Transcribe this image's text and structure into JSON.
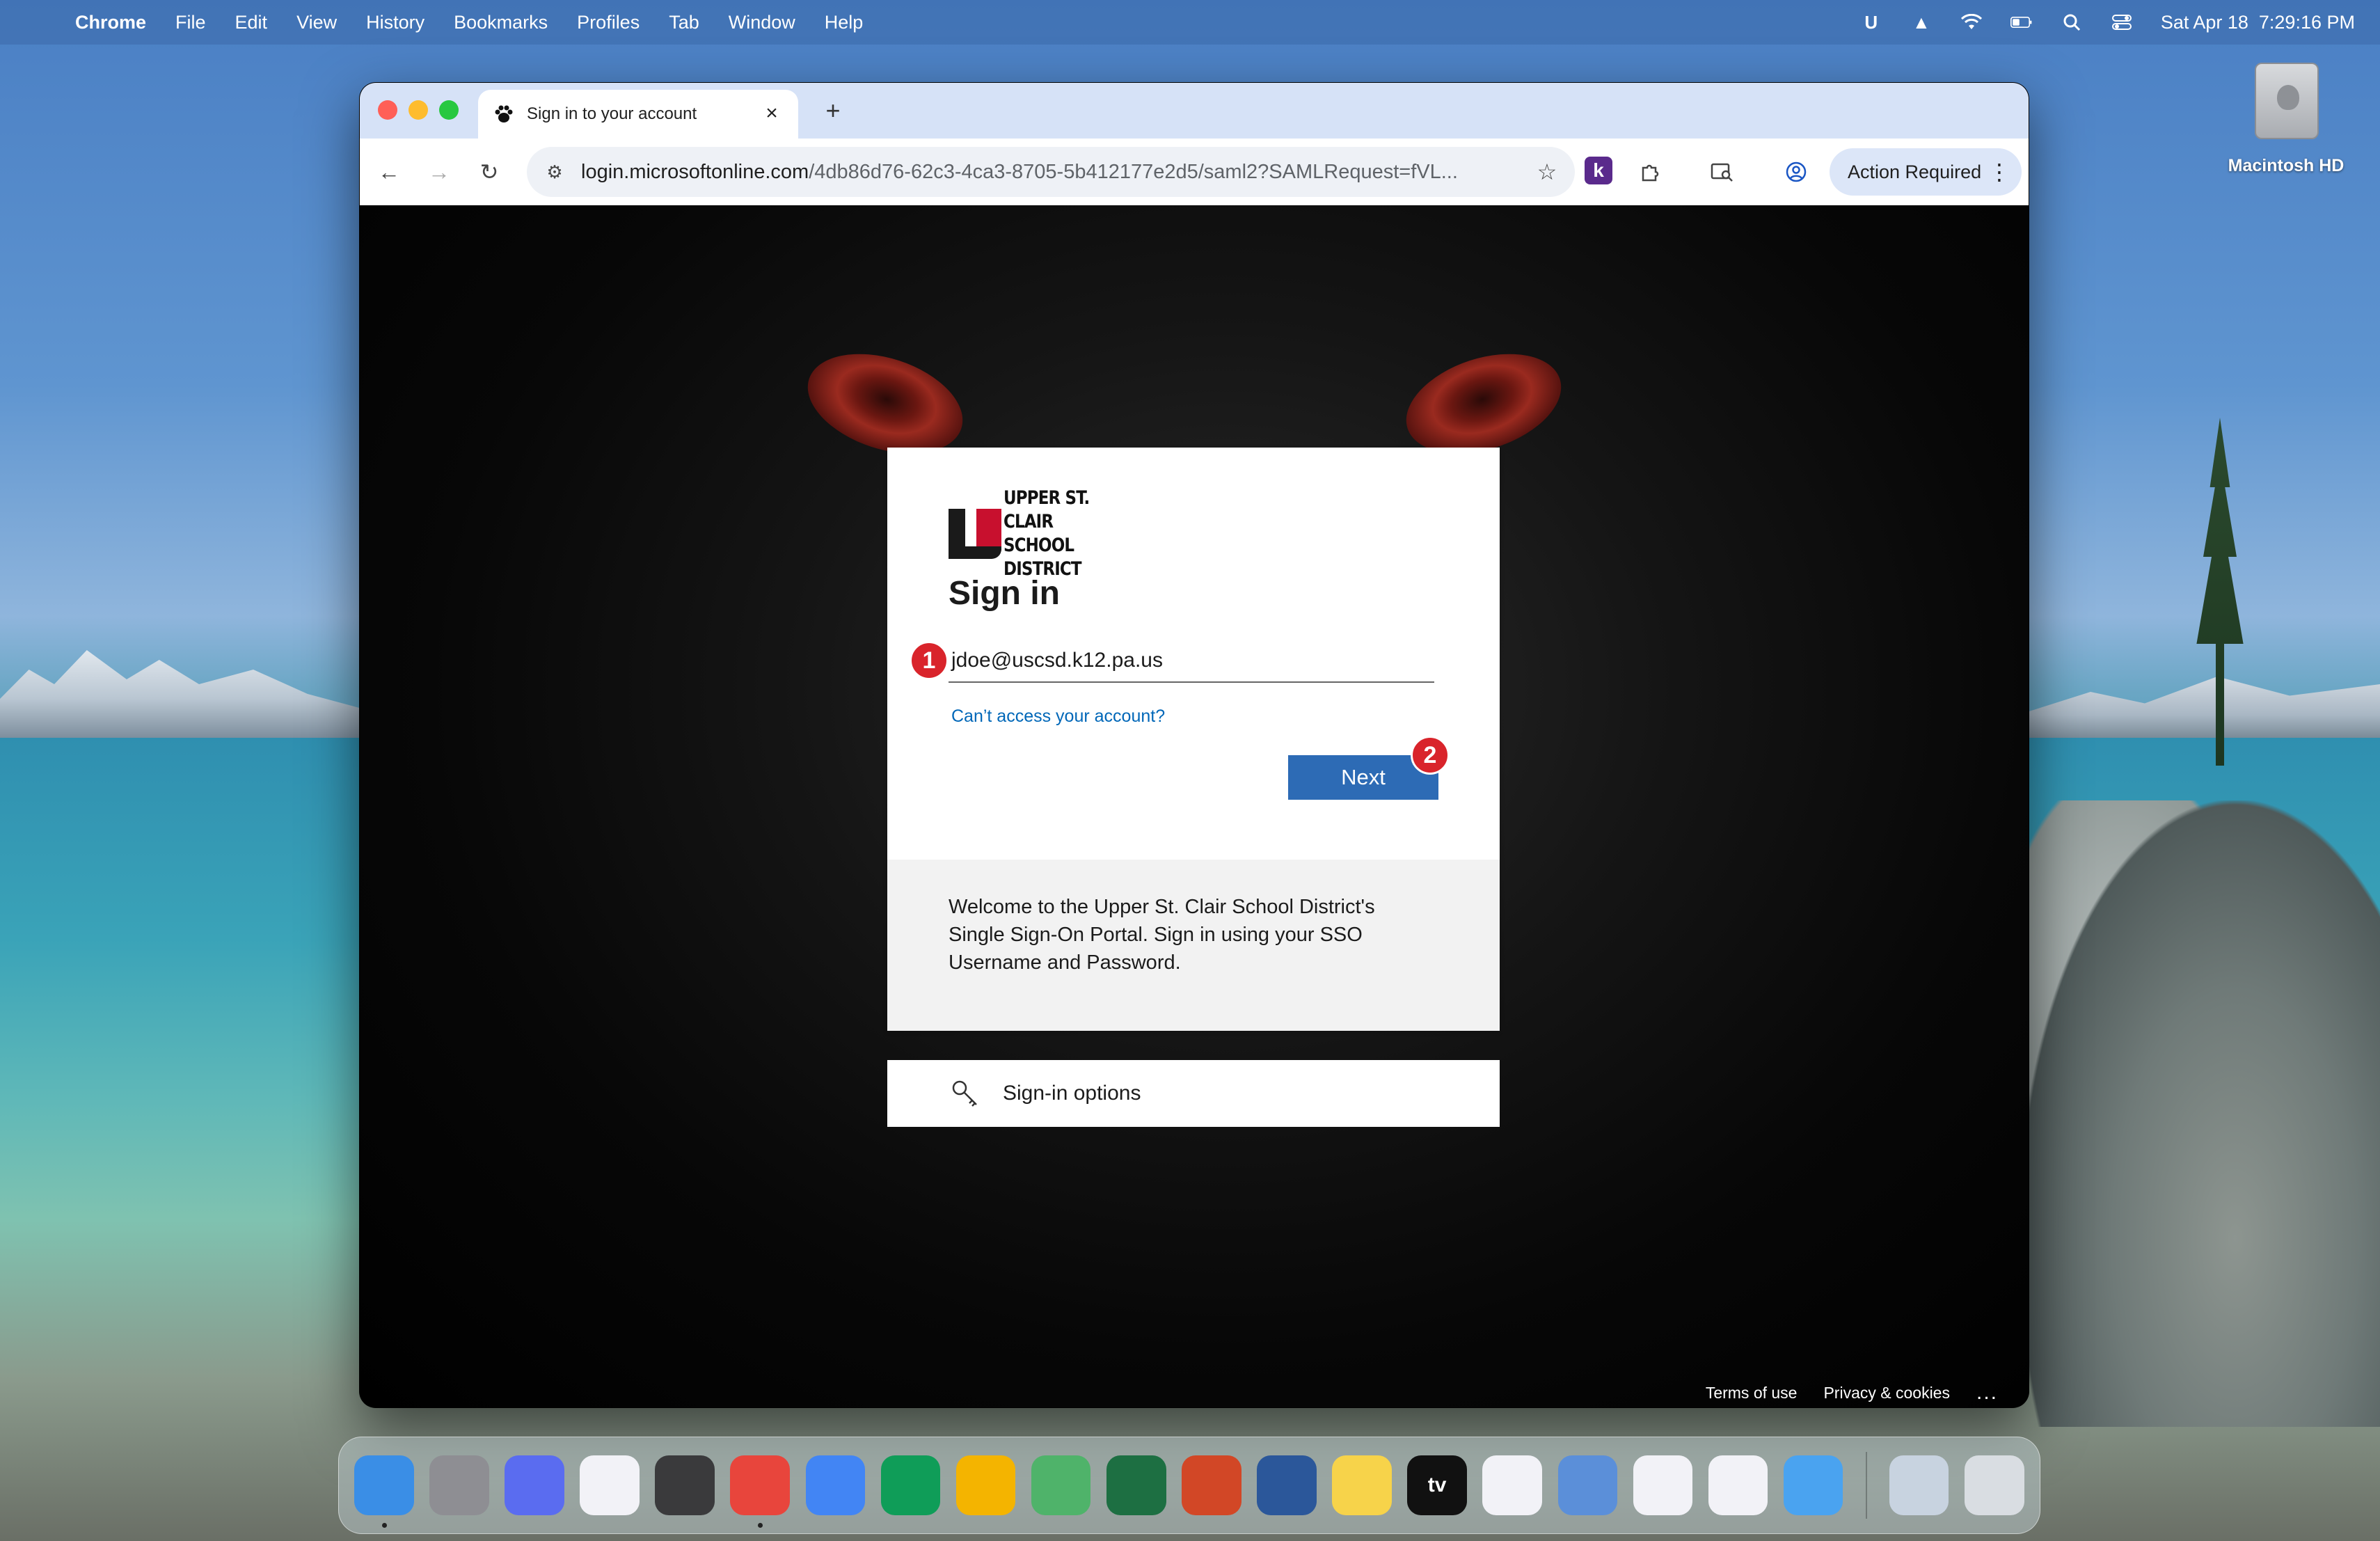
{
  "menubar": {
    "app_name": "Chrome",
    "menus": [
      "File",
      "Edit",
      "View",
      "History",
      "Bookmarks",
      "Profiles",
      "Tab",
      "Window",
      "Help"
    ],
    "status_icons": [
      "u-extension-icon",
      "drive-icon",
      "wifi-icon",
      "battery-icon",
      "spotlight-icon",
      "control-center-icon"
    ],
    "datetime": "Sat Apr 18  7:29:16 PM"
  },
  "desktop": {
    "hd_label": "Macintosh HD"
  },
  "browser": {
    "tab_title": "Sign in to your account",
    "url_domain": "login.microsoftonline.com",
    "url_path": "/4db86d76-62c3-4ca3-8705-5b412177e2d5/saml2?SAMLRequest=fVL...",
    "ext_k_label": "k",
    "action_button": "Action Required"
  },
  "signin": {
    "logo_line1": "UPPER ST. CLAIR",
    "logo_line2": "SCHOOL DISTRICT",
    "title": "Sign in",
    "email_value": "jdoe@uscsd.k12.pa.us",
    "cant_access": "Can’t access your account?",
    "next_label": "Next",
    "badge_1": "1",
    "badge_2": "2",
    "welcome_text": "Welcome to the Upper St. Clair School District's Single Sign-On Portal. Sign in using your SSO Username and Password.",
    "options_label": "Sign-in options",
    "footer_terms": "Terms of use",
    "footer_privacy": "Privacy & cookies",
    "footer_more": "..."
  },
  "dock": {
    "apps": [
      {
        "name": "finder",
        "color": "#3a8ee6",
        "running": true
      },
      {
        "name": "system-settings",
        "color": "#8e8e93",
        "running": false
      },
      {
        "name": "iphone-mirroring",
        "color": "#5a6cf0",
        "running": false
      },
      {
        "name": "launchpad",
        "color": "#f2f2f7",
        "running": false
      },
      {
        "name": "calculator",
        "color": "#3a3a3c",
        "running": false
      },
      {
        "name": "chrome",
        "color": "#e8453c",
        "running": true
      },
      {
        "name": "google-docs",
        "color": "#4285f4",
        "running": false
      },
      {
        "name": "google-sheets",
        "color": "#0f9d58",
        "running": false
      },
      {
        "name": "google-slides",
        "color": "#f4b400",
        "running": false
      },
      {
        "name": "maps",
        "color": "#4fb36a",
        "running": false
      },
      {
        "name": "excel",
        "color": "#1d6f42",
        "running": false
      },
      {
        "name": "powerpoint",
        "color": "#d24726",
        "running": false
      },
      {
        "name": "word",
        "color": "#2b579a",
        "running": false
      },
      {
        "name": "notes",
        "color": "#f7d34a",
        "running": false
      },
      {
        "name": "apple-tv",
        "color": "#111111",
        "running": false
      },
      {
        "name": "photos",
        "color": "#f2f2f7",
        "running": false
      },
      {
        "name": "self-service",
        "color": "#5b8fd9",
        "running": false
      },
      {
        "name": "reminders",
        "color": "#f2f2f7",
        "running": false
      },
      {
        "name": "slack",
        "color": "#f2f2f7",
        "running": false
      },
      {
        "name": "weather",
        "color": "#4aa3f0",
        "running": false
      }
    ],
    "extras": [
      {
        "name": "downloads-stack",
        "color": "#c8d3e0"
      },
      {
        "name": "trash",
        "color": "#d9dde2"
      }
    ],
    "tv_label": "tv"
  }
}
